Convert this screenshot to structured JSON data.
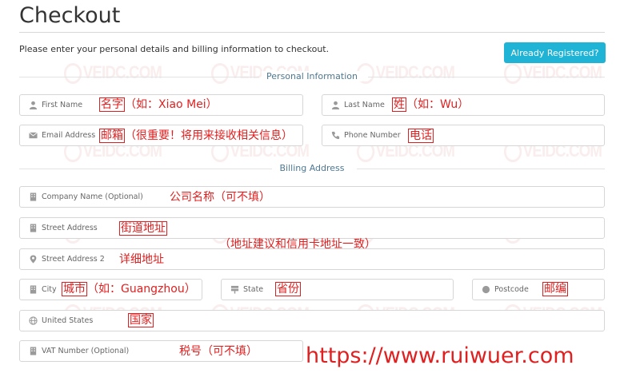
{
  "page": {
    "title": "Checkout",
    "intro": "Please enter your personal details and billing information to checkout.",
    "already_registered_label": "Already Registered?"
  },
  "sections": {
    "personal": "Personal Information",
    "billing": "Billing Address"
  },
  "fields": {
    "first_name": "First Name",
    "last_name": "Last Name",
    "email": "Email Address",
    "phone": "Phone Number",
    "company": "Company Name (Optional)",
    "street1": "Street Address",
    "street2": "Street Address 2",
    "city": "City",
    "state": "State",
    "postcode": "Postcode",
    "country": "United States",
    "vat": "VAT Number (Optional)"
  },
  "annotations": {
    "first_name_box": "名字",
    "first_name_rest": "（如：Xiao Mei）",
    "last_name_box": "姓",
    "last_name_rest": "（如：Wu）",
    "email_box": "邮箱",
    "email_rest": "（很重要！将用来接收相关信息）",
    "phone_box": "电话",
    "company": "公司名称（可不填）",
    "street_box": "街道地址",
    "address_note": "（地址建议和信用卡地址一致）",
    "street2": "详细地址",
    "city_box": "城市",
    "city_rest": "（如：Guangzhou）",
    "state_box": "省份",
    "postcode_box": "邮编",
    "country_box": "国家",
    "vat": "税号（可不填）"
  },
  "watermark": {
    "text": "VEIDC.COM",
    "url": "https://www.ruiwuer.com"
  },
  "icons": {
    "first_name": "user-icon",
    "last_name": "user-icon",
    "email": "envelope-icon",
    "phone": "phone-icon",
    "company": "building-icon",
    "street1": "building-icon",
    "street2": "map-marker-icon",
    "city": "building-icon",
    "state": "signpost-icon",
    "postcode": "circle-icon",
    "country": "globe-icon",
    "vat": "building-icon"
  },
  "colors": {
    "accent_button": "#1fb3d6",
    "section_label": "#4e7891",
    "annotation": "#e02020"
  }
}
